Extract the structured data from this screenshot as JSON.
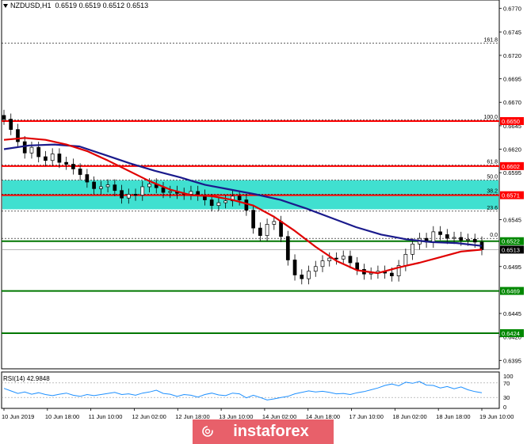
{
  "header": {
    "symbol": "NZDUSD,H1",
    "quotes": "0.6519 0.6512 0.6513",
    "open": "0.6519"
  },
  "rsi_label": "RSI(14) 42.9848",
  "logo": {
    "text": "instaforex",
    "color": "#e8606a",
    "icon": "spiral-logo-icon"
  },
  "colors": {
    "background": "#ffffff",
    "red_line": "#ff0000",
    "green_line": "#007700",
    "zone": "#40e0d0",
    "ma_fast": "#e00000",
    "ma_slow": "#1a1a8c",
    "rsi_line": "#1e90ff",
    "candle_up": "#000000",
    "candle_down": "#000000",
    "price_tag_red": "#ff0000",
    "price_tag_green": "#008800",
    "price_tag_current": "#000000"
  },
  "chart_data": {
    "type": "line",
    "title": "NZDUSD,H1",
    "x_labels": [
      "10 Jun 2019",
      "10 Jun 18:00",
      "11 Jun 10:00",
      "12 Jun 02:00",
      "12 Jun 18:00",
      "13 Jun 10:00",
      "14 Jun 02:00",
      "14 Jun 18:00",
      "17 Jun 10:00",
      "18 Jun 02:00",
      "18 Jun 18:00",
      "19 Jun 10:00"
    ],
    "y_ticks": [
      "0.6770",
      "0.6745",
      "0.6720",
      "0.6695",
      "0.6670",
      "0.6645",
      "0.6620",
      "0.6595",
      "0.6545",
      "0.6495",
      "0.6445",
      "0.6420",
      "0.6395"
    ],
    "ylim": [
      0.6386,
      0.6779
    ],
    "price_tags": [
      {
        "label": "0.6650",
        "value": 0.665,
        "kind": "red"
      },
      {
        "label": "0.6602",
        "value": 0.6602,
        "kind": "red"
      },
      {
        "label": "0.6571",
        "value": 0.6571,
        "kind": "red"
      },
      {
        "label": "0.6522",
        "value": 0.6522,
        "kind": "green"
      },
      {
        "label": "0.6513",
        "value": 0.6513,
        "kind": "current"
      },
      {
        "label": "0.6469",
        "value": 0.6469,
        "kind": "green"
      },
      {
        "label": "0.6424",
        "value": 0.6424,
        "kind": "green"
      }
    ],
    "fib_levels": [
      {
        "label": "161.8",
        "value": 0.6733
      },
      {
        "label": "100.0",
        "value": 0.6651
      },
      {
        "label": "61.8",
        "value": 0.6603
      },
      {
        "label": "50.0",
        "value": 0.6587
      },
      {
        "label": "38.2",
        "value": 0.6572
      },
      {
        "label": "23.6",
        "value": 0.6554
      },
      {
        "label": "0.0",
        "value": 0.6525
      }
    ],
    "zone": [
      0.6556,
      0.6587
    ],
    "close_series": [
      0.6652,
      0.6641,
      0.6628,
      0.6616,
      0.6622,
      0.6612,
      0.6608,
      0.6615,
      0.6606,
      0.6604,
      0.6599,
      0.6593,
      0.6585,
      0.6578,
      0.658,
      0.6582,
      0.6576,
      0.6568,
      0.6572,
      0.6571,
      0.658,
      0.6583,
      0.6579,
      0.6574,
      0.6575,
      0.6573,
      0.6572,
      0.6575,
      0.6571,
      0.6566,
      0.656,
      0.6563,
      0.6565,
      0.657,
      0.6566,
      0.6555,
      0.6536,
      0.6528,
      0.654,
      0.6543,
      0.6527,
      0.6502,
      0.6486,
      0.6482,
      0.649,
      0.6495,
      0.6501,
      0.6504,
      0.6503,
      0.6506,
      0.6499,
      0.6492,
      0.6487,
      0.6488,
      0.649,
      0.6488,
      0.6485,
      0.6496,
      0.6508,
      0.6519,
      0.6525,
      0.6521,
      0.6532,
      0.6529,
      0.6525,
      0.6526,
      0.6523,
      0.6524,
      0.6521,
      0.6513
    ],
    "ma_fast": [
      0.663,
      0.6632,
      0.663,
      0.6625,
      0.6618,
      0.6608,
      0.6597,
      0.6586,
      0.6577,
      0.6571,
      0.657,
      0.6566,
      0.656,
      0.6548,
      0.6533,
      0.6516,
      0.6501,
      0.6491,
      0.6488,
      0.6494,
      0.6499,
      0.6505,
      0.6511,
      0.6513
    ],
    "ma_slow": [
      0.662,
      0.6624,
      0.6625,
      0.6623,
      0.6614,
      0.6605,
      0.6597,
      0.659,
      0.6582,
      0.6577,
      0.6572,
      0.6566,
      0.6557,
      0.6547,
      0.6537,
      0.6529,
      0.6524,
      0.6521,
      0.652,
      0.6517
    ],
    "rsi": {
      "label": "RSI(14) 42.9848",
      "levels": [
        "70",
        "30"
      ],
      "scale": [
        "100",
        "0"
      ],
      "values": [
        55,
        48,
        41,
        45,
        39,
        43,
        38,
        35,
        39,
        42,
        36,
        33,
        38,
        35,
        38,
        41,
        44,
        38,
        40,
        36,
        42,
        45,
        50,
        41,
        39,
        33,
        38,
        36,
        31,
        38,
        42,
        37,
        35,
        42,
        40,
        29,
        36,
        30,
        23,
        26,
        30,
        33,
        40,
        44,
        48,
        45,
        47,
        44,
        40,
        41,
        38,
        43,
        46,
        51,
        56,
        63,
        67,
        62,
        72,
        69,
        74,
        64,
        63,
        56,
        60,
        54,
        59,
        51,
        46,
        43
      ]
    }
  }
}
